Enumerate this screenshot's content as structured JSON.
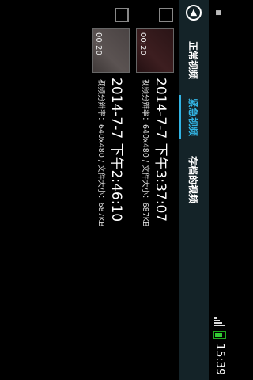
{
  "statusbar": {
    "left_icon": "sd-card-icon",
    "time": "15:39"
  },
  "tabs": [
    {
      "label": "正常视频",
      "selected": false
    },
    {
      "label": "紧急视频",
      "selected": true
    },
    {
      "label": "存档的视频",
      "selected": false
    }
  ],
  "videos": [
    {
      "duration": "00:20",
      "title": "2014-7-7 下午3:37:07",
      "meta": "视频分辨率：640x480 / 文件大小：687KB",
      "checked": false
    },
    {
      "duration": "00:20",
      "title": "2014-7-7 下午2:46:10",
      "meta": "视频分辨率：640x480 / 文件大小：687KB",
      "checked": false
    }
  ],
  "colors": {
    "accent": "#33b5e5",
    "tabbar_bg": "#142328",
    "battery": "#33cc33"
  }
}
